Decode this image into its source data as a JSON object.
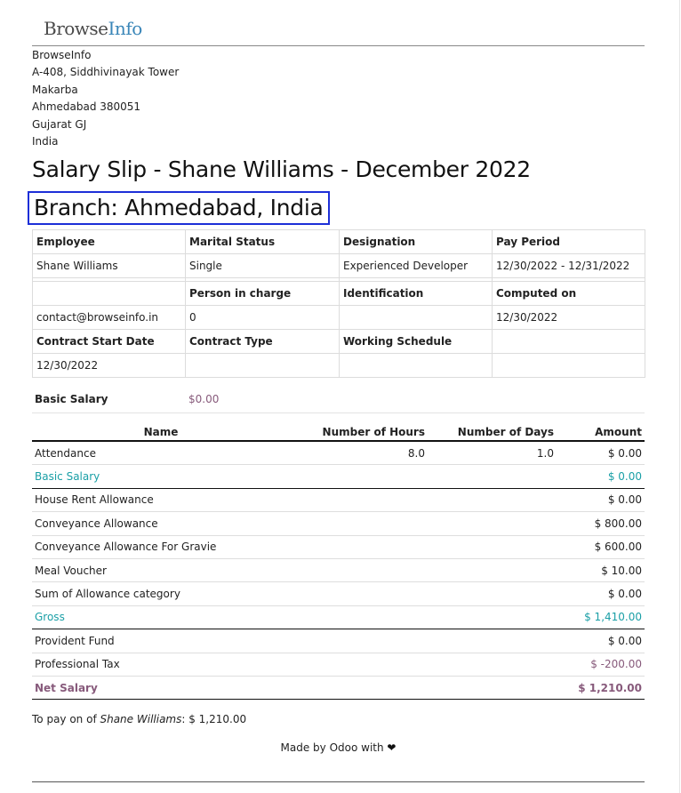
{
  "logo": {
    "part1": "Browse",
    "part2": "Info"
  },
  "company": {
    "name": "BrowseInfo",
    "address_lines": [
      "A-408, Siddhivinayak Tower",
      "Makarba",
      "Ahmedabad 380051",
      "Gujarat GJ",
      "India"
    ]
  },
  "slip": {
    "title": "Salary Slip - Shane Williams - December 2022",
    "branch": "Branch: Ahmedabad, India"
  },
  "info": {
    "employee_label": "Employee",
    "employee": "Shane Williams",
    "marital_label": "Marital Status",
    "marital": "Single",
    "designation_label": "Designation",
    "designation": "Experienced Developer",
    "pay_period_label": "Pay Period",
    "pay_period": "12/30/2022 - 12/31/2022",
    "email": "contact@browseinfo.in",
    "person_label": "Person in charge",
    "person": "0",
    "identification_label": "Identification",
    "identification": "",
    "computed_label": "Computed on",
    "computed": "12/30/2022",
    "contract_start_label": "Contract Start Date",
    "contract_start": "12/30/2022",
    "contract_type_label": "Contract Type",
    "contract_type": "",
    "schedule_label": "Working Schedule",
    "schedule": ""
  },
  "basic": {
    "label": "Basic Salary",
    "value": "$0.00"
  },
  "lines": {
    "headers": {
      "name": "Name",
      "hours": "Number of Hours",
      "days": "Number of Days",
      "amount": "Amount"
    },
    "attendance": {
      "name": "Attendance",
      "hours": "8.0",
      "days": "1.0",
      "amount": "$ 0.00"
    },
    "rows": [
      {
        "name": "Basic Salary",
        "amount": "$ 0.00"
      },
      {
        "name": "House Rent Allowance",
        "amount": "$ 0.00"
      },
      {
        "name": "Conveyance Allowance",
        "amount": "$ 800.00"
      },
      {
        "name": "Conveyance Allowance For Gravie",
        "amount": "$ 600.00"
      },
      {
        "name": "Meal Voucher",
        "amount": "$ 10.00"
      },
      {
        "name": "Sum of Allowance category",
        "amount": "$ 0.00"
      },
      {
        "name": "Gross",
        "amount": "$ 1,410.00"
      },
      {
        "name": "Provident Fund",
        "amount": "$ 0.00"
      },
      {
        "name": "Professional Tax",
        "amount": "$ -200.00"
      },
      {
        "name": "Net Salary",
        "amount": "$ 1,210.00"
      }
    ]
  },
  "topay": {
    "prefix": "To pay on of ",
    "employee": "Shane Williams",
    "suffix": ": $ 1,210.00"
  },
  "footer": {
    "text": "Made by Odoo with",
    "heart": "❤"
  },
  "colors": {
    "teal": "#1a9fa6",
    "plum": "#875a7b",
    "branch_border": "#1d2fd8",
    "logo_blue": "#3a86b8"
  }
}
